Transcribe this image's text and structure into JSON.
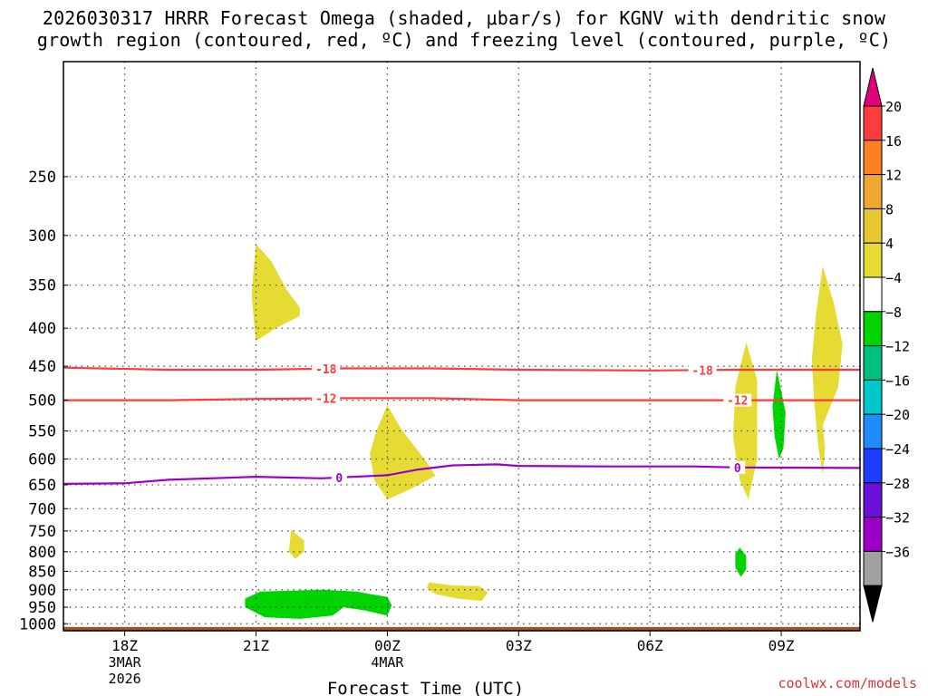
{
  "title_line1": "2026030317 HRRR Forecast Omega (shaded, μbar/s) for KGNV with dendritic snow",
  "title_line2": "growth region (contoured, red, ºC) and freezing level (contoured, purple, ºC)",
  "credit": "coolwx.com/models",
  "chart_data": {
    "type": "time-height",
    "xlabel": "Forecast Time (UTC)",
    "x_range_hours": [
      -1.4,
      16.8
    ],
    "x_ticks": [
      {
        "hour": 0,
        "label": "18Z",
        "sub1": "3MAR",
        "sub2": "2026"
      },
      {
        "hour": 3,
        "label": "21Z"
      },
      {
        "hour": 6,
        "label": "00Z",
        "sub1": "4MAR"
      },
      {
        "hour": 9,
        "label": "03Z"
      },
      {
        "hour": 12,
        "label": "06Z"
      },
      {
        "hour": 15,
        "label": "09Z"
      }
    ],
    "y_levels_hpa": [
      250,
      300,
      350,
      400,
      450,
      500,
      550,
      600,
      650,
      700,
      750,
      800,
      850,
      900,
      950,
      1000
    ],
    "y_range_hpa": [
      175,
      1022
    ],
    "y_scale": "log",
    "surface_hpa": 1010,
    "contours": [
      {
        "name": "-18",
        "color": "#ff3b3b",
        "label_hours": [
          4.6,
          13.2
        ],
        "points": [
          [
            -1.4,
            452
          ],
          [
            1,
            455
          ],
          [
            3,
            455
          ],
          [
            5,
            453
          ],
          [
            7,
            453
          ],
          [
            9,
            455
          ],
          [
            12,
            456
          ],
          [
            14,
            455
          ],
          [
            16.8,
            455
          ]
        ]
      },
      {
        "name": "-12",
        "color": "#ff3b3b",
        "label_hours": [
          4.6,
          14.0
        ],
        "points": [
          [
            -1.4,
            500
          ],
          [
            1,
            500
          ],
          [
            3,
            498
          ],
          [
            5,
            497
          ],
          [
            7,
            497
          ],
          [
            9,
            500
          ],
          [
            12,
            500
          ],
          [
            14,
            500
          ],
          [
            16.8,
            500
          ]
        ]
      },
      {
        "name": "0",
        "color": "#9a00c8",
        "label_hours": [
          4.9,
          14.0
        ],
        "points": [
          [
            -1.4,
            648
          ],
          [
            0,
            647
          ],
          [
            1,
            640
          ],
          [
            3,
            634
          ],
          [
            4.5,
            637
          ],
          [
            6,
            631
          ],
          [
            6.7,
            620
          ],
          [
            7.5,
            612
          ],
          [
            8.5,
            610
          ],
          [
            9,
            613
          ],
          [
            11,
            614
          ],
          [
            13,
            614
          ],
          [
            14,
            616
          ],
          [
            16.8,
            617
          ]
        ]
      }
    ],
    "omega_regions": [
      {
        "value": 4,
        "color": "#e6db32",
        "points": [
          [
            3,
            308
          ],
          [
            3.35,
            325
          ],
          [
            3.7,
            355
          ],
          [
            4,
            375
          ],
          [
            4,
            385
          ],
          [
            3.45,
            400
          ],
          [
            3,
            416
          ],
          [
            2.95,
            390
          ],
          [
            2.9,
            360
          ],
          [
            2.95,
            330
          ]
        ]
      },
      {
        "value": 4,
        "color": "#e6db32",
        "points": [
          [
            6,
            508
          ],
          [
            6.3,
            545
          ],
          [
            6.7,
            585
          ],
          [
            6.95,
            612
          ],
          [
            7.1,
            632
          ],
          [
            6.5,
            660
          ],
          [
            6,
            680
          ],
          [
            5.7,
            640
          ],
          [
            5.6,
            590
          ],
          [
            5.75,
            550
          ]
        ]
      },
      {
        "value": 4,
        "color": "#e6db32",
        "points": [
          [
            3.8,
            748
          ],
          [
            4.1,
            772
          ],
          [
            4.1,
            800
          ],
          [
            3.9,
            818
          ],
          [
            3.75,
            800
          ],
          [
            3.78,
            770
          ]
        ]
      },
      {
        "value": 4,
        "color": "#e6db32",
        "points": [
          [
            6.95,
            880
          ],
          [
            7.5,
            888
          ],
          [
            8.1,
            890
          ],
          [
            8.3,
            908
          ],
          [
            8.15,
            932
          ],
          [
            7.6,
            925
          ],
          [
            7.1,
            912
          ],
          [
            6.9,
            895
          ]
        ]
      },
      {
        "value": 4,
        "color": "#e6db32",
        "points": [
          [
            14.2,
            418
          ],
          [
            14.45,
            470
          ],
          [
            14.45,
            600
          ],
          [
            14.25,
            680
          ],
          [
            14.05,
            640
          ],
          [
            13.9,
            560
          ],
          [
            13.95,
            480
          ]
        ]
      },
      {
        "value": 4,
        "color": "#e6db32",
        "points": [
          [
            15.95,
            330
          ],
          [
            16.2,
            370
          ],
          [
            16.4,
            420
          ],
          [
            16.3,
            480
          ],
          [
            15.95,
            540
          ],
          [
            16.0,
            580
          ],
          [
            15.95,
            630
          ],
          [
            15.85,
            580
          ],
          [
            15.75,
            500
          ],
          [
            15.7,
            440
          ],
          [
            15.8,
            380
          ]
        ]
      },
      {
        "value": -4,
        "color": "#00d400",
        "points": [
          [
            2.75,
            925
          ],
          [
            3.1,
            905
          ],
          [
            4.5,
            900
          ],
          [
            5.3,
            905
          ],
          [
            5.6,
            912
          ],
          [
            6,
            920
          ],
          [
            6.1,
            945
          ],
          [
            6.0,
            975
          ],
          [
            5.5,
            960
          ],
          [
            5,
            950
          ],
          [
            4.75,
            975
          ],
          [
            4,
            985
          ],
          [
            3.2,
            980
          ],
          [
            2.75,
            950
          ]
        ]
      },
      {
        "value": -4,
        "color": "#00d400",
        "points": [
          [
            14.9,
            455
          ],
          [
            15.1,
            520
          ],
          [
            15.05,
            580
          ],
          [
            14.95,
            600
          ],
          [
            14.85,
            560
          ],
          [
            14.8,
            510
          ]
        ]
      },
      {
        "value": -4,
        "color": "#00d400",
        "points": [
          [
            14.05,
            790
          ],
          [
            14.2,
            810
          ],
          [
            14.2,
            845
          ],
          [
            14.08,
            865
          ],
          [
            13.95,
            840
          ],
          [
            13.95,
            805
          ]
        ]
      }
    ],
    "colorbar": {
      "labels": [
        "20",
        "16",
        "12",
        "8",
        "4",
        "−4",
        "−8",
        "−12",
        "−16",
        "−20",
        "−24",
        "−28",
        "−32",
        "−36"
      ],
      "colors": [
        "#ff3b3b",
        "#ff7f25",
        "#f0a830",
        "#e8c830",
        "#e6db32",
        "#ffffff",
        "#00d400",
        "#00c080",
        "#00c8c8",
        "#1e8cff",
        "#1e3cff",
        "#6a10d8",
        "#9a00c8",
        "#a0a0a0"
      ],
      "top_color": "#e0007a",
      "bottom_color": "#000000"
    }
  }
}
